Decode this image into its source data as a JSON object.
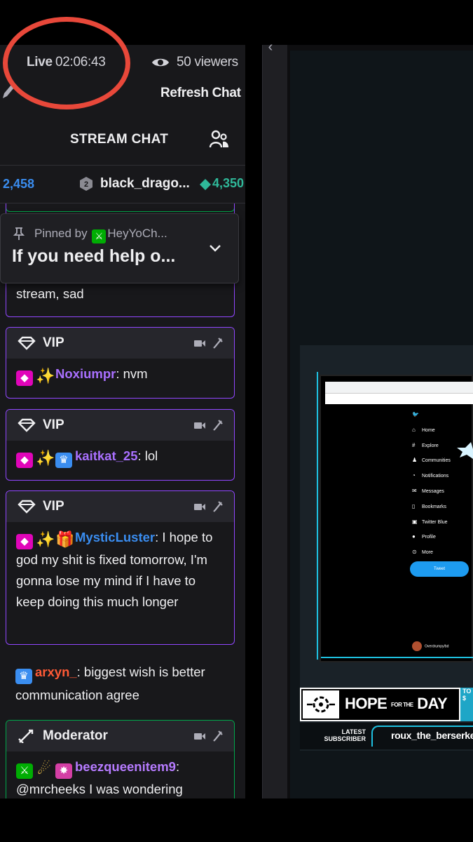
{
  "header": {
    "live_label": "Live",
    "live_time": "02:06:43",
    "viewers": "50 viewers",
    "refresh": "Refresh Chat"
  },
  "chat": {
    "title": "STREAM CHAT",
    "leaderboard": {
      "prev": "2,458",
      "name": "black_drago...",
      "score": "4,350"
    },
    "pinned": {
      "by_label": "Pinned by",
      "by_user": "HeyYoCh...",
      "text": "If you need help o..."
    },
    "partial_text": "stream, sad",
    "messages": [
      {
        "label": "VIP",
        "user": "Noxiumpr",
        "text": ": nvm"
      },
      {
        "label": "VIP",
        "user": "kaitkat_25",
        "text": ": lol"
      },
      {
        "label": "VIP",
        "user": "MysticLuster",
        "text": ": I hope to god my shit is fixed tomorrow, I'm gonna lose my mind if I have to keep doing this much longer"
      },
      {
        "user": "arxyn_",
        "text": ": biggest wish is better communication agree"
      },
      {
        "label": "Moderator",
        "user": "beezqueenitem9",
        "text": ": @mrcheeks I was wondering"
      }
    ]
  },
  "stream": {
    "hope_text": "HOPE",
    "hope_for": "FOR THE",
    "hope_day": "DAY",
    "side_text": "TO $",
    "latest_label": "LATEST SUBSCRIBER",
    "latest_name": "roux_the_berserker",
    "twitter_menu": [
      "Home",
      "Explore",
      "Communities",
      "Notifications",
      "Messages",
      "Bookmarks",
      "Twitter Blue",
      "Profile",
      "More"
    ],
    "tweet_label": "Tweet",
    "account_label": "Overdrumpy/bd"
  },
  "colors": {
    "accent_purple": "#9147ff",
    "mod_green": "#00a84b",
    "highlight_red": "#e8483a"
  }
}
